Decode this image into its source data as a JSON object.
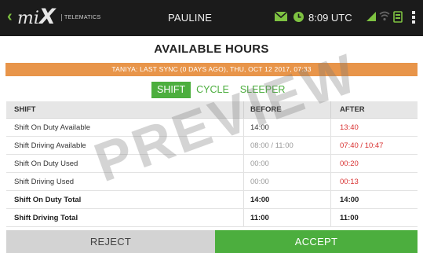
{
  "status_bar": {
    "back_glyph": "‹",
    "logo_text": "mi",
    "logo_x": "X",
    "brand_sub": "TELEMATICS",
    "driver_name": "PAULINE",
    "time": "8:09 UTC",
    "icons": [
      "back-arrow-icon",
      "mix-logo-icon",
      "mail-icon",
      "sync-clock-icon",
      "signal-icon",
      "wifi-icon",
      "device-icon",
      "overflow-menu-icon"
    ],
    "colors": {
      "bar": "#1b1b1b",
      "accent_green": "#7ec241"
    }
  },
  "page": {
    "title": "AVAILABLE HOURS",
    "sync_notice": "TANIYA: LAST SYNC (0 DAYS AGO), THU, OCT 12 2017, 07:33",
    "sync_color": "#e8954a"
  },
  "tabs": [
    {
      "label": "SHIFT",
      "active": true
    },
    {
      "label": "CYCLE",
      "active": false
    },
    {
      "label": "SLEEPER",
      "active": false
    }
  ],
  "table": {
    "columns": [
      "SHIFT",
      "BEFORE",
      "AFTER"
    ],
    "rows": [
      {
        "label": "Shift On Duty Available",
        "before": "14:00",
        "after": "13:40"
      },
      {
        "label": "Shift Driving Available",
        "before": "08:00 / 11:00",
        "after": "07:40 / 10:47"
      },
      {
        "label": "Shift On Duty Used",
        "before": "00:00",
        "after": "00:20"
      },
      {
        "label": "Shift Driving Used",
        "before": "00:00",
        "after": "00:13"
      },
      {
        "label": "Shift On Duty Total",
        "before": "14:00",
        "after": "14:00"
      },
      {
        "label": "Shift Driving Total",
        "before": "11:00",
        "after": "11:00"
      }
    ],
    "changed_color": "#d93232"
  },
  "watermark": "PREVIEW",
  "actions": {
    "reject_label": "REJECT",
    "accept_label": "ACCEPT",
    "accept_color": "#4cae3e"
  }
}
